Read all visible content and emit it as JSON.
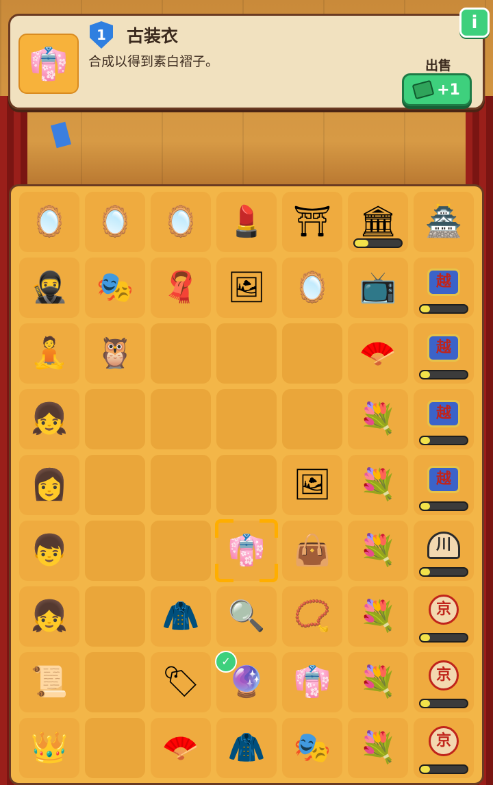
{
  "info_panel": {
    "level": "1",
    "item_name": "古装衣",
    "item_icon": "robe-icon",
    "description": "合成以得到素白褶子。",
    "sell_label": "出售",
    "sell_reward": "+1",
    "info_label": "i"
  },
  "board": {
    "columns": 7,
    "rows": [
      [
        {
          "icon": "vanity-cabinet-icon",
          "glyph": "🪞"
        },
        {
          "icon": "vanity-cabinet-icon",
          "glyph": "🪞"
        },
        {
          "icon": "vanity-cabinet-icon",
          "glyph": "🪞"
        },
        {
          "icon": "dressing-table-icon",
          "glyph": "💄"
        },
        {
          "icon": "opera-stage-gate-icon",
          "glyph": "⛩"
        },
        {
          "icon": "theater-building-icon",
          "glyph": "🏛",
          "progress": 0.3
        },
        {
          "icon": "grand-theater-icon",
          "glyph": "🏯"
        }
      ],
      [
        {
          "icon": "warrior-performer-icon",
          "glyph": "🥷"
        },
        {
          "icon": "red-curtain-icon",
          "glyph": "🎭"
        },
        {
          "icon": "red-cloth-icon",
          "glyph": "🧣"
        },
        {
          "icon": "opera-mask-poster-icon",
          "glyph": "🖼"
        },
        {
          "icon": "hand-mirror-stand-icon",
          "glyph": "🪞"
        },
        {
          "icon": "retro-tv-icon",
          "glyph": "📺"
        },
        {
          "icon": "yue-opera-sign-icon",
          "sign": "越",
          "progress": 0.2
        }
      ],
      [
        {
          "icon": "dancer-performer-icon",
          "glyph": "🧘"
        },
        {
          "icon": "owl-headdress-icon",
          "glyph": "🦉"
        },
        null,
        null,
        null,
        {
          "icon": "folding-fan-icon",
          "glyph": "🪭"
        },
        {
          "icon": "yue-opera-sign-icon",
          "sign": "越",
          "progress": 0.2
        }
      ],
      [
        {
          "icon": "girl-performer-icon",
          "glyph": "👧"
        },
        null,
        null,
        null,
        null,
        {
          "icon": "flower-vanity-mirror-icon",
          "glyph": "💐"
        },
        {
          "icon": "yue-opera-sign-icon",
          "sign": "越",
          "progress": 0.2
        }
      ],
      [
        {
          "icon": "woman-performer-icon",
          "glyph": "👩"
        },
        null,
        null,
        null,
        {
          "icon": "mask-portrait-icon",
          "glyph": "🖼"
        },
        {
          "icon": "flower-vanity-mirror-icon",
          "glyph": "💐"
        },
        {
          "icon": "yue-opera-sign-icon",
          "sign": "越",
          "progress": 0.2
        }
      ],
      [
        {
          "icon": "boy-performer-icon",
          "glyph": "👦"
        },
        null,
        null,
        {
          "icon": "white-robe-icon",
          "glyph": "👘",
          "selected": true
        },
        {
          "icon": "opera-mask-bag-icon",
          "glyph": "👜"
        },
        {
          "icon": "flower-vanity-mirror-icon",
          "glyph": "💐"
        },
        {
          "icon": "chuan-opera-sign-icon",
          "sign": "川",
          "progress": 0.2
        }
      ],
      [
        {
          "icon": "green-dress-girl-icon",
          "glyph": "👧"
        },
        null,
        {
          "icon": "white-coat-icon",
          "glyph": "🧥"
        },
        {
          "icon": "hand-mirror-icon",
          "glyph": "🔍"
        },
        {
          "icon": "mask-necklace-icon",
          "glyph": "📿"
        },
        {
          "icon": "flower-vanity-mirror-icon",
          "glyph": "💐"
        },
        {
          "icon": "jing-opera-sign-icon",
          "sign": "京",
          "progress": 0.2
        }
      ],
      [
        {
          "icon": "scroll-icon",
          "glyph": "📜"
        },
        null,
        {
          "icon": "mask-tag-icon",
          "glyph": "🏷"
        },
        {
          "icon": "opera-mask-orb-icon",
          "glyph": "🔮",
          "checked": true
        },
        {
          "icon": "blue-costume-icon",
          "glyph": "👘"
        },
        {
          "icon": "flower-vanity-mirror-icon",
          "glyph": "💐"
        },
        {
          "icon": "jing-opera-sign-icon",
          "sign": "京",
          "progress": 0.2
        }
      ],
      [
        {
          "icon": "phoenix-crown-icon",
          "glyph": "👑"
        },
        null,
        {
          "icon": "fan-and-stick-icon",
          "glyph": "🪭"
        },
        {
          "icon": "embroidered-cape-icon",
          "glyph": "🧥"
        },
        {
          "icon": "black-opera-mask-icon",
          "glyph": "🎭"
        },
        {
          "icon": "flower-vanity-mirror-icon",
          "glyph": "💐"
        },
        {
          "icon": "jing-opera-sign-icon",
          "sign": "京",
          "progress": 0.2
        }
      ]
    ]
  }
}
